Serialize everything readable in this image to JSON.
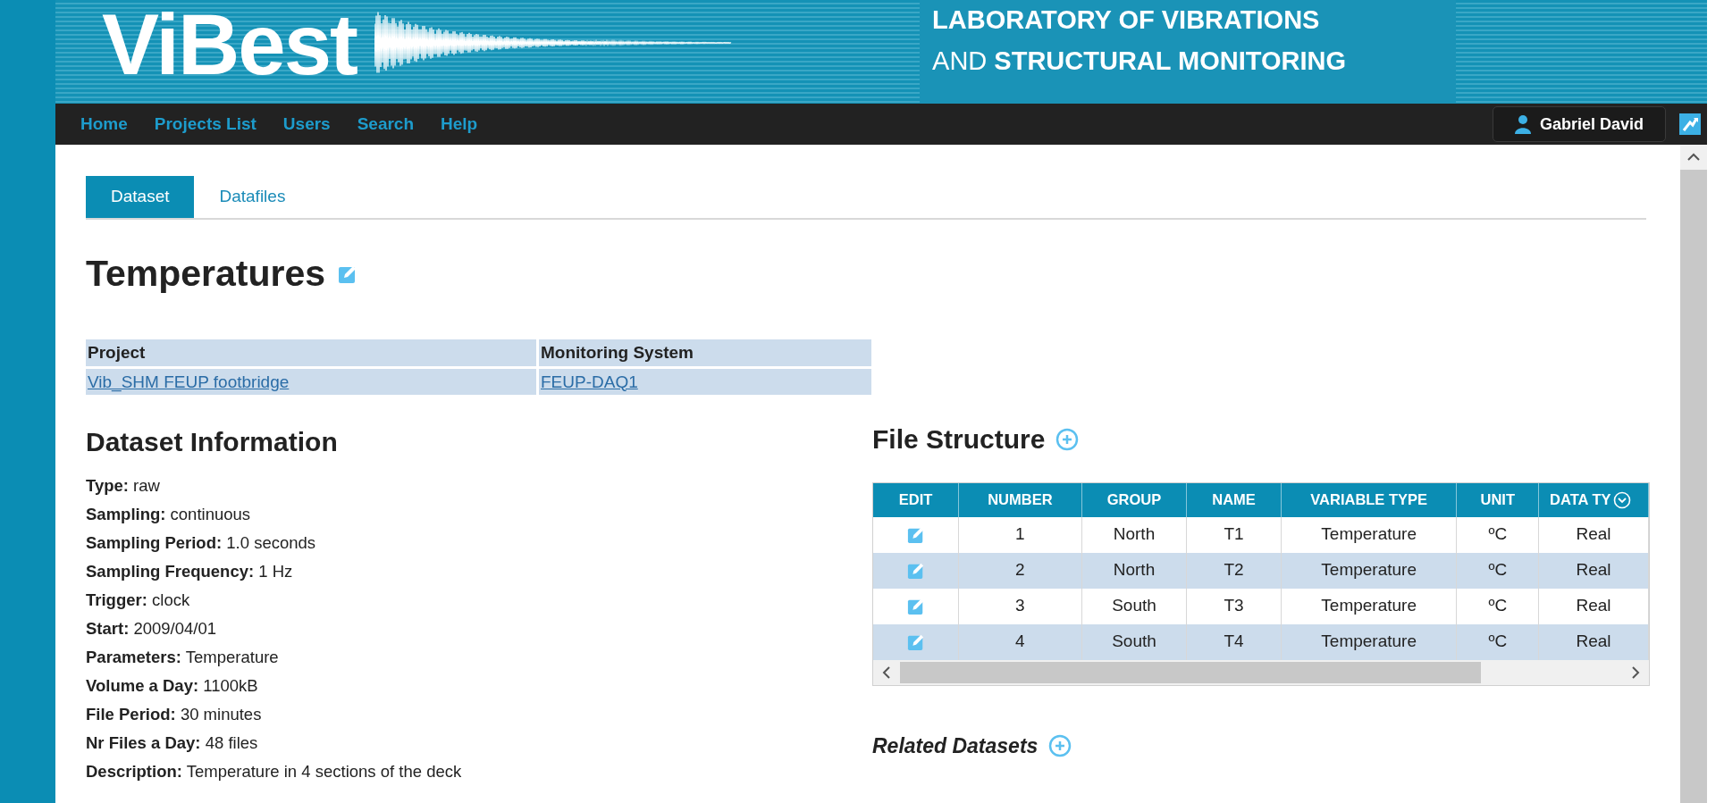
{
  "banner": {
    "logo": "ViBest",
    "lab_line_1": "LABORATORY OF VIBRATIONS",
    "lab_line_2": "AND **STRUCTURAL MONITORING**"
  },
  "nav": {
    "links": [
      "Home",
      "Projects List",
      "Users",
      "Search",
      "Help"
    ],
    "user": "Gabriel David"
  },
  "tabs": [
    {
      "label": "Dataset",
      "selected": true
    },
    {
      "label": "Datafiles",
      "selected": false
    }
  ],
  "title": "Temperatures",
  "info_table": {
    "columns": [
      "Project",
      "Monitoring System"
    ],
    "values": [
      "Vib_SHM FEUP footbridge",
      "FEUP-DAQ1"
    ]
  },
  "dataset_information": {
    "heading": "Dataset Information",
    "fields": [
      {
        "label": "Type:",
        "value": "raw"
      },
      {
        "label": "Sampling:",
        "value": "continuous"
      },
      {
        "label": "Sampling Period:",
        "value": "1.0 seconds"
      },
      {
        "label": "Sampling Frequency:",
        "value": "1 Hz"
      },
      {
        "label": "Trigger:",
        "value": "clock"
      },
      {
        "label": "Start:",
        "value": "2009/04/01"
      },
      {
        "label": "Parameters:",
        "value": "Temperature"
      },
      {
        "label": "Volume a Day:",
        "value": "1100kB"
      },
      {
        "label": "File Period:",
        "value": "30 minutes"
      },
      {
        "label": "Nr Files a Day:",
        "value": "48 files"
      },
      {
        "label": "Description:",
        "value": "Temperature in 4 sections of the deck"
      }
    ]
  },
  "file_structure": {
    "heading": "File Structure",
    "columns": [
      "EDIT",
      "NUMBER",
      "GROUP",
      "NAME",
      "VARIABLE TYPE",
      "UNIT",
      "DATA TY"
    ],
    "rows": [
      [
        "",
        "1",
        "North",
        "T1",
        "Temperature",
        "ºC",
        "Real"
      ],
      [
        "",
        "2",
        "North",
        "T2",
        "Temperature",
        "ºC",
        "Real"
      ],
      [
        "",
        "3",
        "South",
        "T3",
        "Temperature",
        "ºC",
        "Real"
      ],
      [
        "",
        "4",
        "South",
        "T4",
        "Temperature",
        "ºC",
        "Real"
      ]
    ]
  },
  "related": {
    "heading": "Related Datasets"
  }
}
